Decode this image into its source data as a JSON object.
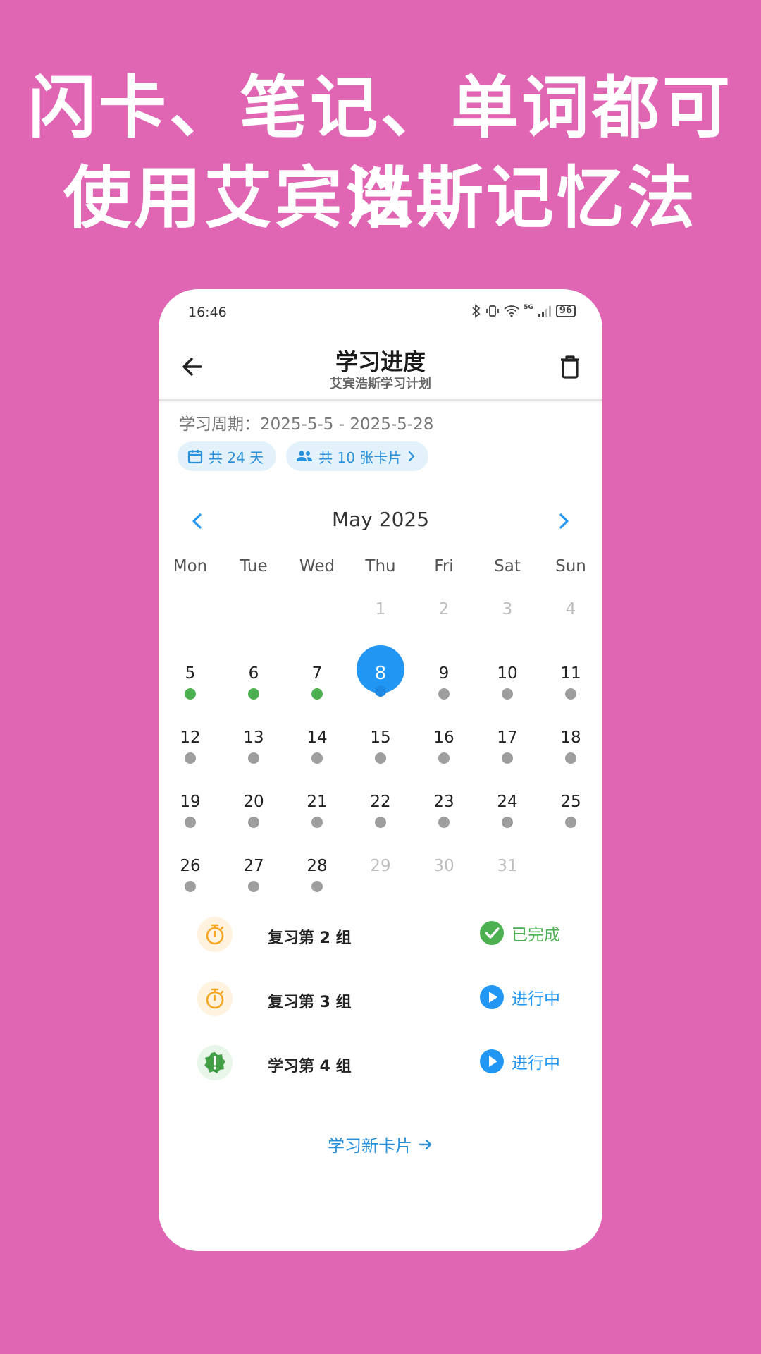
{
  "headline": {
    "line1": "闪卡、笔记、单词都可以",
    "line2": "使用艾宾浩斯记忆法"
  },
  "status_bar": {
    "time": "16:46",
    "network": "5G",
    "battery": "96"
  },
  "app_bar": {
    "title": "学习进度",
    "subtitle": "艾宾浩斯学习计划",
    "back_icon": "arrow-left-icon",
    "delete_icon": "trash-icon"
  },
  "plan": {
    "period": "学习周期：2025-5-5 - 2025-5-28",
    "days_chip": "共 24 天",
    "cards_chip": "共 10 张卡片"
  },
  "calendar": {
    "month_label": "May 2025",
    "weekdays": [
      "Mon",
      "Tue",
      "Wed",
      "Thu",
      "Fri",
      "Sat",
      "Sun"
    ],
    "days": [
      {
        "n": "",
        "muted": false,
        "dot": "none"
      },
      {
        "n": "",
        "muted": false,
        "dot": "none"
      },
      {
        "n": "",
        "muted": false,
        "dot": "none"
      },
      {
        "n": "1",
        "muted": true,
        "dot": "none"
      },
      {
        "n": "2",
        "muted": true,
        "dot": "none"
      },
      {
        "n": "3",
        "muted": true,
        "dot": "none"
      },
      {
        "n": "4",
        "muted": true,
        "dot": "none"
      },
      {
        "n": "5",
        "muted": false,
        "dot": "done"
      },
      {
        "n": "6",
        "muted": false,
        "dot": "done"
      },
      {
        "n": "7",
        "muted": false,
        "dot": "done"
      },
      {
        "n": "8",
        "muted": false,
        "dot": "today",
        "today": true
      },
      {
        "n": "9",
        "muted": false,
        "dot": "pending"
      },
      {
        "n": "10",
        "muted": false,
        "dot": "pending"
      },
      {
        "n": "11",
        "muted": false,
        "dot": "pending"
      },
      {
        "n": "12",
        "muted": false,
        "dot": "pending"
      },
      {
        "n": "13",
        "muted": false,
        "dot": "pending"
      },
      {
        "n": "14",
        "muted": false,
        "dot": "pending"
      },
      {
        "n": "15",
        "muted": false,
        "dot": "pending"
      },
      {
        "n": "16",
        "muted": false,
        "dot": "pending"
      },
      {
        "n": "17",
        "muted": false,
        "dot": "pending"
      },
      {
        "n": "18",
        "muted": false,
        "dot": "pending"
      },
      {
        "n": "19",
        "muted": false,
        "dot": "pending"
      },
      {
        "n": "20",
        "muted": false,
        "dot": "pending"
      },
      {
        "n": "21",
        "muted": false,
        "dot": "pending"
      },
      {
        "n": "22",
        "muted": false,
        "dot": "pending"
      },
      {
        "n": "23",
        "muted": false,
        "dot": "pending"
      },
      {
        "n": "24",
        "muted": false,
        "dot": "pending"
      },
      {
        "n": "25",
        "muted": false,
        "dot": "pending"
      },
      {
        "n": "26",
        "muted": false,
        "dot": "pending"
      },
      {
        "n": "27",
        "muted": false,
        "dot": "pending"
      },
      {
        "n": "28",
        "muted": false,
        "dot": "pending"
      },
      {
        "n": "29",
        "muted": true,
        "dot": "none"
      },
      {
        "n": "30",
        "muted": true,
        "dot": "none"
      },
      {
        "n": "31",
        "muted": true,
        "dot": "none"
      }
    ]
  },
  "tasks": [
    {
      "label": "复习第 2 组",
      "icon": "stopwatch-icon",
      "icon_tone": "orange",
      "status": "已完成",
      "state": "done"
    },
    {
      "label": "复习第 3 组",
      "icon": "stopwatch-icon",
      "icon_tone": "orange",
      "status": "进行中",
      "state": "progress"
    },
    {
      "label": "学习第 4 组",
      "icon": "alert-badge-icon",
      "icon_tone": "green",
      "status": "进行中",
      "state": "progress"
    }
  ],
  "new_cards_link": "学习新卡片",
  "colors": {
    "background": "#e066b3",
    "accent_blue": "#2196f3",
    "done_green": "#4caf50",
    "pending_gray": "#9e9e9e",
    "timer_orange": "#f5a623"
  }
}
